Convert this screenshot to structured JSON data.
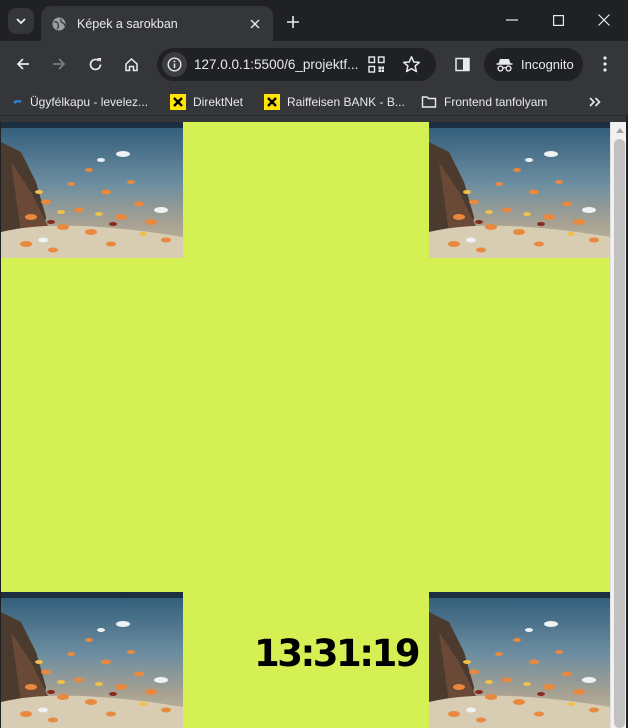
{
  "browser": {
    "tab": {
      "title": "Képek a sarokban",
      "favicon": "globe-icon"
    },
    "new_tab_icon": "plus-icon",
    "window_controls": [
      "minimize-icon",
      "maximize-icon",
      "close-icon"
    ],
    "address": {
      "url": "127.0.0.1:5500/6_projektf...",
      "icons": [
        "info-icon",
        "qr-code-icon",
        "star-icon"
      ]
    },
    "incognito_label": "Incognito",
    "bookmarks": [
      {
        "label": "Ügyfélkapu - levelez...",
        "icon": "ugyfelkapu-icon"
      },
      {
        "label": "DirektNet",
        "icon": "raiffeisen-icon"
      },
      {
        "label": "Raiffeisen BANK - B...",
        "icon": "raiffeisen-icon"
      },
      {
        "label": "Frontend tanfolyam",
        "icon": "folder-icon"
      }
    ],
    "colors": {
      "tab_strip": "#202124",
      "toolbar": "#35363a"
    }
  },
  "page": {
    "clock": "13:31:19",
    "corner_images": [
      "top-left",
      "top-right",
      "bottom-left",
      "bottom-right"
    ],
    "colors": {
      "background": "#d4f052",
      "clock": "#000000"
    }
  }
}
